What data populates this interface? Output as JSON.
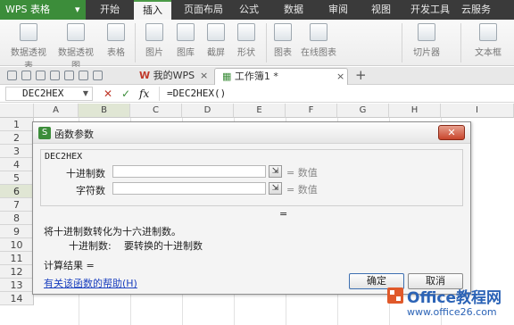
{
  "app": {
    "title": "WPS 表格"
  },
  "menu": {
    "tabs": [
      "开始",
      "插入",
      "页面布局",
      "公式",
      "数据",
      "审阅",
      "视图",
      "开发工具",
      "云服务"
    ],
    "active": "插入"
  },
  "ribbon": {
    "buttons": [
      "数据透视表",
      "数据透视图",
      "表格",
      "图片",
      "图库",
      "截屏",
      "形状",
      "图表",
      "在线图表",
      "切片器",
      "文本框"
    ]
  },
  "doc_tabs": [
    {
      "label": "我的WPS"
    },
    {
      "label": "工作簿1 *"
    }
  ],
  "formula_bar": {
    "cell_ref": "DEC2HEX",
    "fx": "fx",
    "formula": "=DEC2HEX()"
  },
  "columns": [
    "A",
    "B",
    "C",
    "D",
    "E",
    "F",
    "G",
    "H",
    "I"
  ],
  "rows": [
    "1",
    "2",
    "3",
    "4",
    "5",
    "6",
    "7",
    "8",
    "9",
    "10",
    "11",
    "12",
    "13",
    "14"
  ],
  "dialog": {
    "title": "函数参数",
    "function_name": "DEC2HEX",
    "args": [
      {
        "label": "十进制数",
        "value": "",
        "result": "= 数值"
      },
      {
        "label": "字符数",
        "value": "",
        "result": "= 数值"
      }
    ],
    "result_eq": "=",
    "description": "将十进制数转化为十六进制数。",
    "arg_desc_label": "十进制数:",
    "arg_desc_text": "要转换的十进制数",
    "calc_result_label": "计算结果 =",
    "help_link": "有关该函数的帮助(H)",
    "ok_label": "确定",
    "cancel_label": "取消"
  },
  "watermark": {
    "brand": "Office教程网",
    "url": "www.office26.com"
  }
}
